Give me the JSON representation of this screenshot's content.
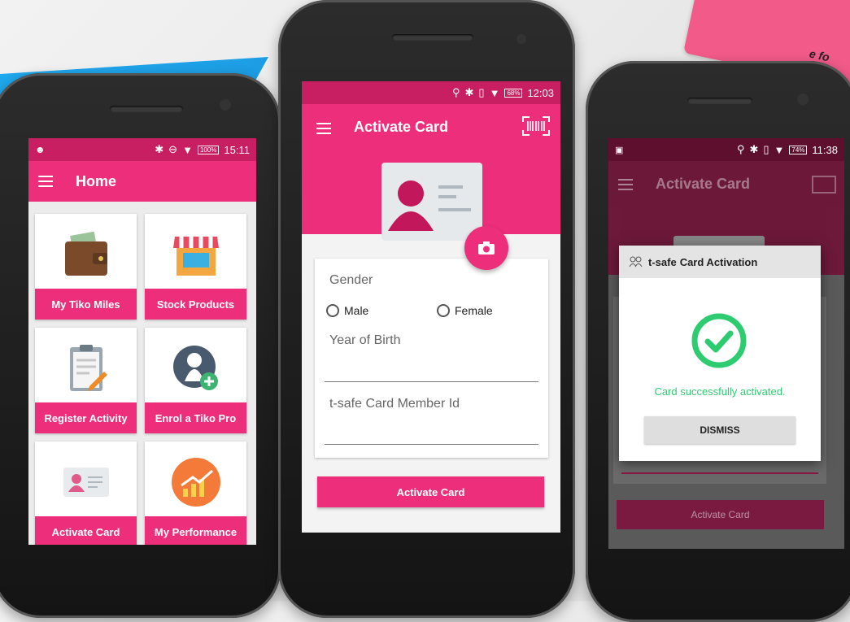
{
  "background": {
    "accent_blue": "#1fa9ee",
    "card_text": "e fo"
  },
  "phone_left": {
    "status": {
      "battery": "100%",
      "time": "15:11"
    },
    "appbar_title": "Home",
    "tiles": [
      {
        "label": "My Tiko Miles",
        "icon": "wallet-icon"
      },
      {
        "label": "Stock Products",
        "icon": "store-icon"
      },
      {
        "label": "Register Activity",
        "icon": "clipboard-icon"
      },
      {
        "label": "Enrol a Tiko Pro",
        "icon": "add-user-icon"
      },
      {
        "label": "Activate Card",
        "icon": "id-card-icon"
      },
      {
        "label": "My Performance",
        "icon": "chart-icon"
      }
    ]
  },
  "phone_center": {
    "status": {
      "battery": "68%",
      "time": "12:03"
    },
    "appbar_title": "Activate Card",
    "form": {
      "gender_label": "Gender",
      "option_male": "Male",
      "option_female": "Female",
      "year_label": "Year of Birth",
      "member_id_label": "t-safe Card Member Id"
    },
    "submit_label": "Activate Card"
  },
  "phone_right": {
    "status": {
      "battery": "74%",
      "time": "11:38"
    },
    "appbar_title": "Activate Card",
    "submit_label": "Activate Card",
    "dialog": {
      "title_prefix": "t-safe",
      "title_suffix": "Card Activation",
      "message": "Card successfully activated.",
      "dismiss_label": "DISMISS"
    }
  },
  "colors": {
    "primary": "#ec2e7b",
    "success": "#2ecc71"
  }
}
